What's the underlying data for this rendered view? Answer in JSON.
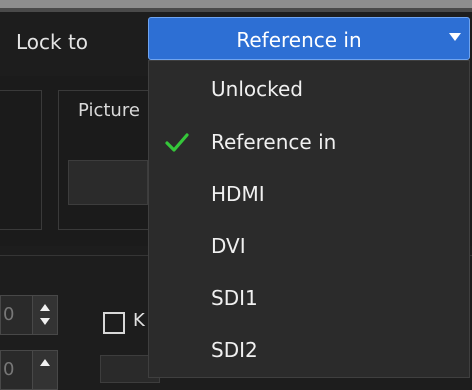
{
  "header": {
    "lock_label": "Lock to"
  },
  "combo": {
    "selected": "Reference in",
    "accent": "#2d6fd4"
  },
  "background": {
    "picture_label": "Picture",
    "spin_value_1": "0",
    "spin_value_2": "0",
    "checkbox_label": "K"
  },
  "dropdown": {
    "options": [
      {
        "label": "Unlocked",
        "checked": false
      },
      {
        "label": "Reference in",
        "checked": true
      },
      {
        "label": "HDMI",
        "checked": false
      },
      {
        "label": "DVI",
        "checked": false
      },
      {
        "label": "SDI1",
        "checked": false
      },
      {
        "label": "SDI2",
        "checked": false
      }
    ],
    "check_color": "#35c73a"
  }
}
